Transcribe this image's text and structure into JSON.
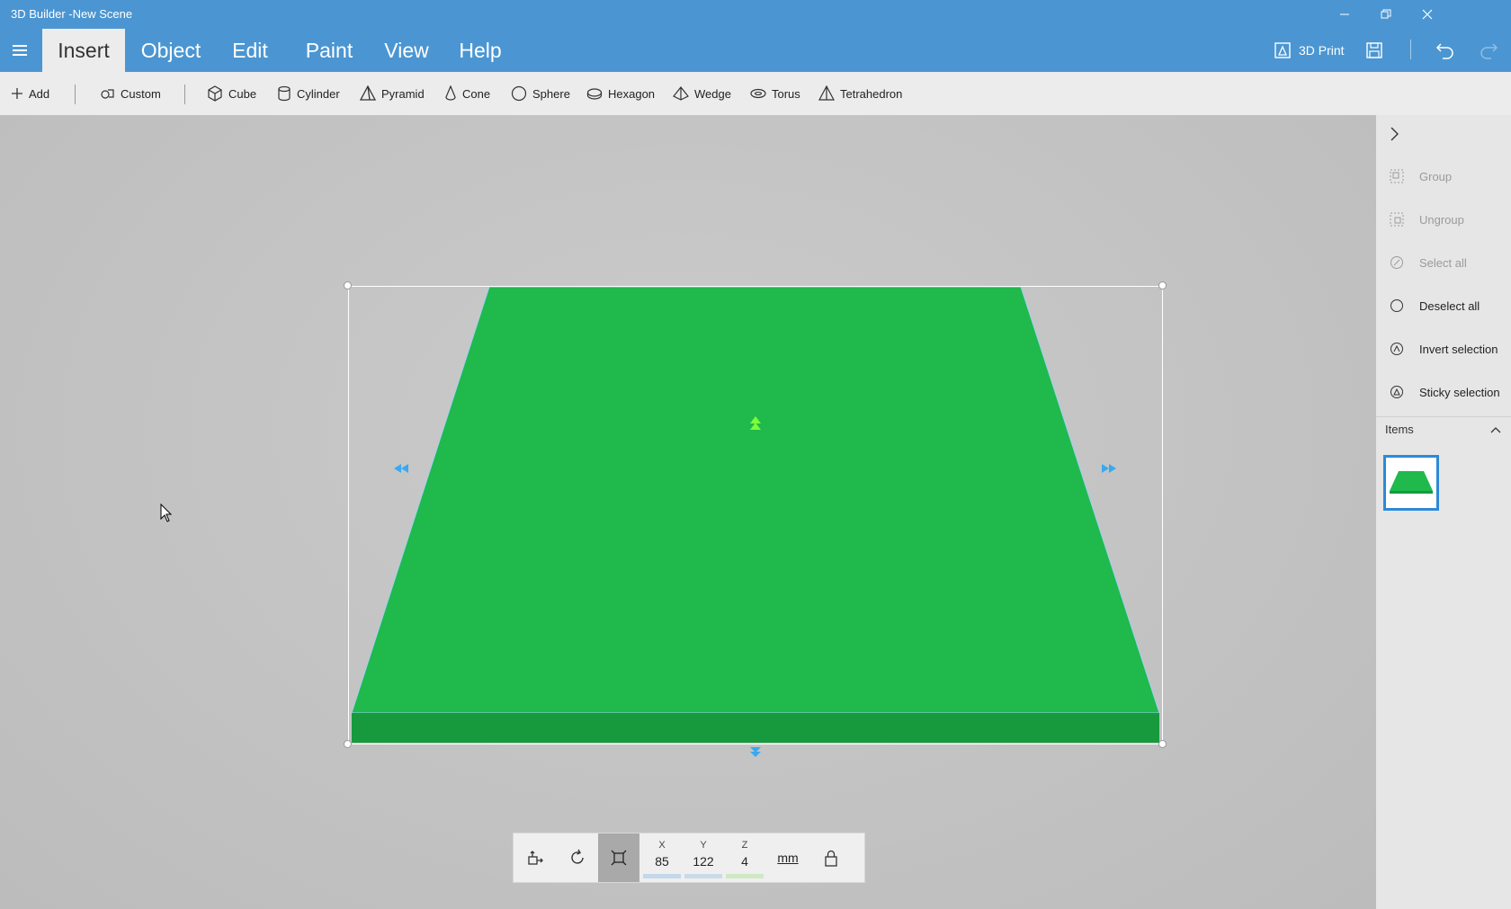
{
  "window": {
    "title": "3D Builder -New Scene"
  },
  "ribbon": {
    "tabs": [
      "Insert",
      "Object",
      "Edit",
      "Paint",
      "View",
      "Help"
    ],
    "active_tab": "Insert",
    "print_label": "3D Print"
  },
  "toolbar": {
    "add_label": "Add",
    "custom_label": "Custom",
    "shapes": [
      "Cube",
      "Cylinder",
      "Pyramid",
      "Cone",
      "Sphere",
      "Hexagon",
      "Wedge",
      "Torus",
      "Tetrahedron"
    ]
  },
  "transform": {
    "x_label": "X",
    "x_value": "85",
    "y_label": "Y",
    "y_value": "122",
    "z_label": "Z",
    "z_value": "4",
    "unit": "mm"
  },
  "panel": {
    "actions": [
      {
        "label": "Group",
        "enabled": false
      },
      {
        "label": "Ungroup",
        "enabled": false
      },
      {
        "label": "Select all",
        "enabled": false
      },
      {
        "label": "Deselect all",
        "enabled": true
      },
      {
        "label": "Invert selection",
        "enabled": true
      },
      {
        "label": "Sticky selection",
        "enabled": true
      }
    ],
    "items_label": "Items"
  },
  "colors": {
    "accent": "#4b96d2",
    "object_top": "#1fb94c",
    "object_side": "#179a3d",
    "selection_arrow": "#39a9f0",
    "elevate_arrow": "#7dff3a"
  }
}
